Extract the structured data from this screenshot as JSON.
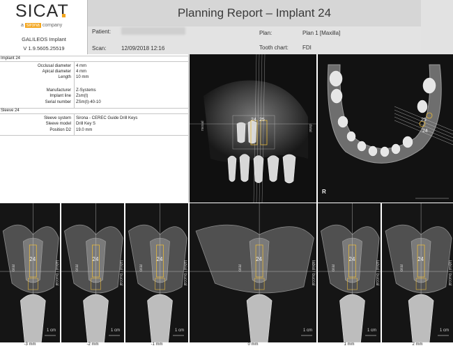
{
  "header": {
    "logo": "SICAT",
    "logo_tag_prefix": "a",
    "logo_tag_brand": "sirona",
    "logo_tag_suffix": "company",
    "product_name": "GALILEOS Implant",
    "product_version": "V 1.9.5605.25519",
    "title": "Planning Report – Implant 24",
    "patient_label": "Patient:",
    "scan_label": "Scan:",
    "scan_value": "12/09/2018 12:16",
    "plan_label": "Plan:",
    "plan_value": "Plan 1 [Maxilla]",
    "tooth_chart_label": "Tooth chart:",
    "tooth_chart_value": "FDI"
  },
  "implant": {
    "section": "Implant 24",
    "rows": [
      {
        "key": "Occlusal diameter",
        "value": "4 mm"
      },
      {
        "key": "Apical diameter",
        "value": "4 mm"
      },
      {
        "key": "Length",
        "value": "10 mm"
      },
      {
        "key": "Manufacturer",
        "value": "Z-Systems"
      },
      {
        "key": "Implant line",
        "value": "Zsm(t)"
      },
      {
        "key": "Serial number",
        "value": "ZSm(t)-40-10"
      }
    ]
  },
  "sleeve": {
    "section": "Sleeve 24",
    "rows": [
      {
        "key": "Sleeve system",
        "value": "Sirona - CEREC Guide Drill Keys"
      },
      {
        "key": "Sleeve model",
        "value": "Drill Key S"
      },
      {
        "key": "Position D2",
        "value": "19.0 mm"
      }
    ]
  },
  "views": {
    "sagittal_tooth_labels": [
      "24",
      "25"
    ],
    "sagittal_side_left": "mesial",
    "sagittal_side_right": "distal",
    "axial_tooth_labels": [
      "25",
      "24"
    ],
    "axial_orientation": "R"
  },
  "slices": [
    {
      "caption": "-3 mm",
      "tooth": "24",
      "scale": "1 cm",
      "right_label": "labial / buccal",
      "left_label": "oral"
    },
    {
      "caption": "-2 mm",
      "tooth": "24",
      "scale": "1 cm",
      "right_label": "labial / buccal",
      "left_label": "oral"
    },
    {
      "caption": "-1 mm",
      "tooth": "24",
      "scale": "1 cm",
      "right_label": "labial / buccal",
      "left_label": "oral"
    },
    {
      "caption": "0 mm",
      "tooth": "24",
      "scale": "1 cm",
      "right_label": "labial / buccal",
      "left_label": "oral"
    },
    {
      "caption": "1 mm",
      "tooth": "24",
      "scale": "1 cm",
      "right_label": "labial / buccal",
      "left_label": "oral"
    },
    {
      "caption": "2 mm",
      "tooth": "24",
      "scale": "1 cm",
      "right_label": "labial / buccal",
      "left_label": "oral"
    }
  ]
}
